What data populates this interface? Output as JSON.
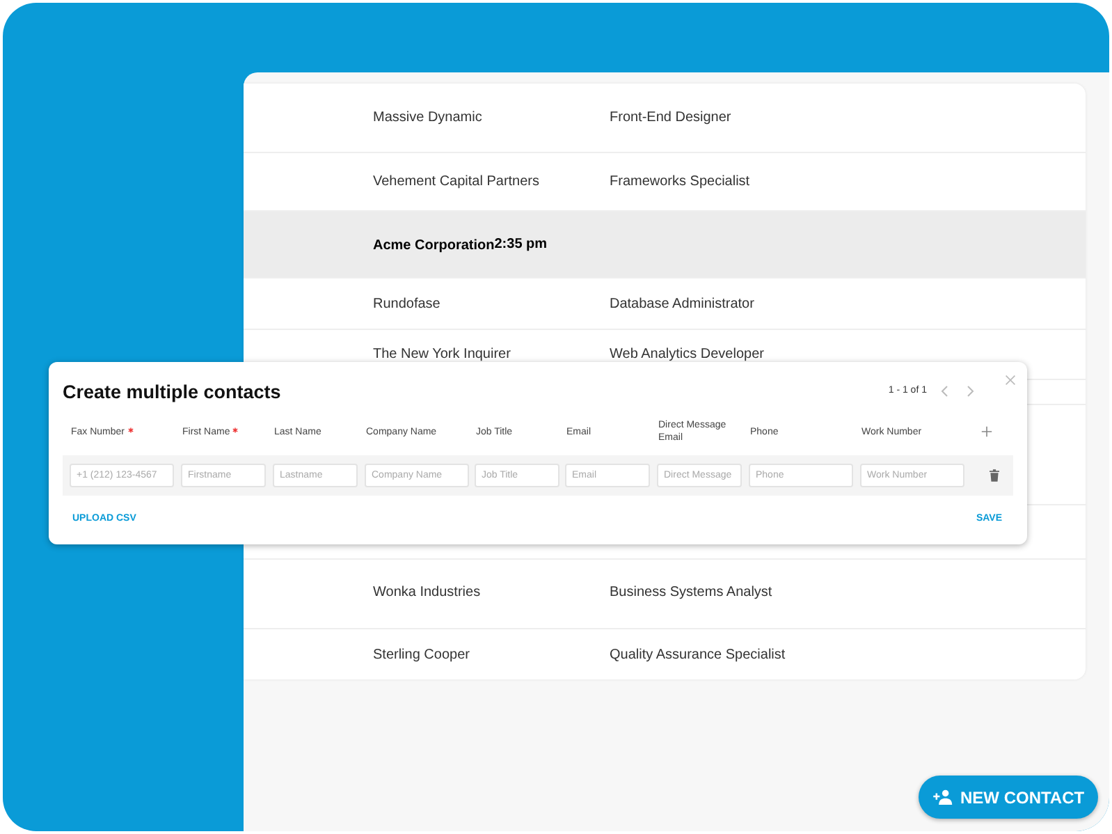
{
  "contacts": [
    {
      "company": "Massive Dynamic",
      "job_title": "Front-End Designer",
      "selected": false
    },
    {
      "company": "Vehement Capital Partners",
      "job_title": "Frameworks Specialist",
      "selected": false
    },
    {
      "company": "Acme Corporation",
      "time": "2:35 pm",
      "selected": true
    },
    {
      "company": "Rundofase",
      "job_title": "Database Administrator",
      "selected": false
    },
    {
      "company": "The New York Inquirer",
      "job_title": "Web Analytics Developer",
      "selected": false
    },
    {
      "company": "Wonka Industries",
      "job_title": "Business Systems Analyst",
      "selected": false
    },
    {
      "company": "Sterling Cooper",
      "job_title": "Quality Assurance Specialist",
      "selected": false
    }
  ],
  "dialog": {
    "title": "Create multiple contacts",
    "pagination": "1 - 1 of 1",
    "fields": [
      {
        "label": "Fax Number",
        "required": true,
        "placeholder": "+1 (212) 123-4567"
      },
      {
        "label": "First Name",
        "required": true,
        "placeholder": "Firstname"
      },
      {
        "label": "Last Name",
        "required": false,
        "placeholder": "Lastname"
      },
      {
        "label": "Company Name",
        "required": false,
        "placeholder": "Company Name"
      },
      {
        "label": "Job Title",
        "required": false,
        "placeholder": "Job Title"
      },
      {
        "label": "Email",
        "required": false,
        "placeholder": "Email"
      },
      {
        "label": "Direct Message Email",
        "required": false,
        "placeholder": "Direct Message"
      },
      {
        "label": "Phone",
        "required": false,
        "placeholder": "Phone"
      },
      {
        "label": "Work Number",
        "required": false,
        "placeholder": "Work Number"
      }
    ],
    "upload_button": "UPLOAD CSV",
    "save_button": "SAVE"
  },
  "new_contact_button": "NEW CONTACT"
}
